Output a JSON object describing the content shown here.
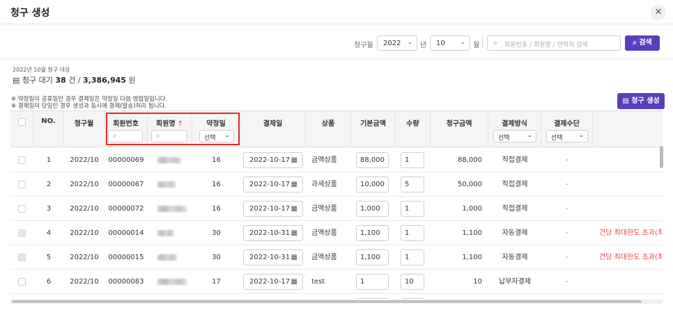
{
  "modal": {
    "title": "청구 생성",
    "close_icon": "✕"
  },
  "filter": {
    "month_label": "청구월",
    "year": "2022",
    "year_unit": "년",
    "month": "10",
    "month_unit": "월",
    "search_placeholder": "회원번호 / 회원명 / 연락처 검색",
    "search_button": "검색"
  },
  "summary": {
    "period": "2022년 10월 청구 대상",
    "prefix": "청구 대기 ",
    "count": "38",
    "count_unit": " 건 / ",
    "amount": "3,386,945",
    "amount_unit": " 원"
  },
  "notes": [
    "※ 약정일이 공휴일인 경우 결제일은 약정일 다음 영업일입니다.",
    "※ 결제일이 당일인 경우 생성과 동시에 결제(발송)처리 됩니다."
  ],
  "create_button": "청구 생성",
  "columns": {
    "no": "NO.",
    "month": "청구월",
    "member_no": "회원번호",
    "member_name": "회원명",
    "sort_arrow": "↑",
    "contract_day": "약정일",
    "pay_date": "결제일",
    "product": "상품",
    "base_amount": "기본금액",
    "qty": "수량",
    "bill_amount": "청구금액",
    "pay_method": "결제방식",
    "pay_means": "결제수단"
  },
  "header_filters": {
    "select_label": "선택"
  },
  "rows": [
    {
      "no": "1",
      "month": "2022/10",
      "member_no": "00000069",
      "contract_day": "16",
      "pay_date": "2022-10-17",
      "product": "금액상품",
      "base": "88,000",
      "qty": "1",
      "bill": "88,000",
      "method": "직접결제",
      "means": "-",
      "note": "",
      "disabled": false
    },
    {
      "no": "2",
      "month": "2022/10",
      "member_no": "00000067",
      "contract_day": "16",
      "pay_date": "2022-10-17",
      "product": "과세상품",
      "base": "10,000",
      "qty": "5",
      "bill": "50,000",
      "method": "직접결제",
      "means": "-",
      "note": "",
      "disabled": false
    },
    {
      "no": "3",
      "month": "2022/10",
      "member_no": "00000072",
      "contract_day": "16",
      "pay_date": "2022-10-17",
      "product": "금액상품",
      "base": "1,000",
      "qty": "1",
      "bill": "1,000",
      "method": "직접결제",
      "means": "-",
      "note": "",
      "disabled": false
    },
    {
      "no": "4",
      "month": "2022/10",
      "member_no": "00000014",
      "contract_day": "30",
      "pay_date": "2022-10-31",
      "product": "금액상품",
      "base": "1,100",
      "qty": "1",
      "bill": "1,100",
      "method": "자동결제",
      "means": "-",
      "note": "건당 최대한도 초과(최대",
      "disabled": true
    },
    {
      "no": "5",
      "month": "2022/10",
      "member_no": "00000015",
      "contract_day": "30",
      "pay_date": "2022-10-31",
      "product": "금액상품",
      "base": "1,100",
      "qty": "1",
      "bill": "1,100",
      "method": "자동결제",
      "means": "-",
      "note": "건당 최대한도 초과(최대",
      "disabled": true
    },
    {
      "no": "6",
      "month": "2022/10",
      "member_no": "00000083",
      "contract_day": "17",
      "pay_date": "2022-10-17",
      "product": "test",
      "base": "1",
      "qty": "10",
      "bill": "10",
      "method": "납부자결제",
      "means": "-",
      "note": "",
      "disabled": false
    }
  ],
  "icons": {
    "chevron": "⌄",
    "search": "⌕",
    "calendar": "▦",
    "doc": "▤"
  }
}
